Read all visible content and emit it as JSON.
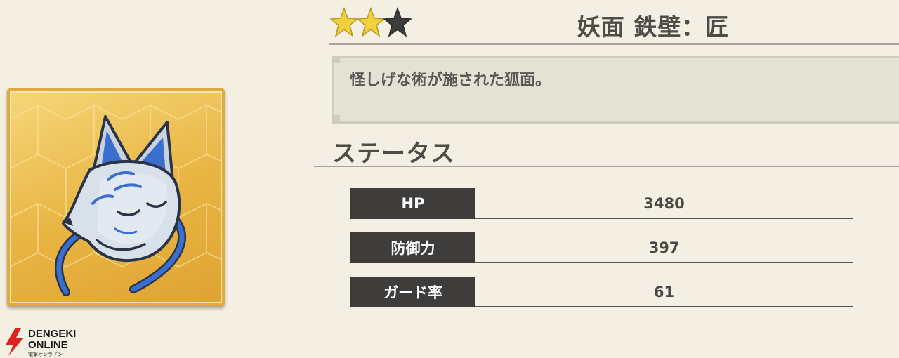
{
  "item": {
    "rarity": 2,
    "rarity_max": 3,
    "name": "妖面 鉄壁：匠",
    "description": "怪しげな術が施された狐面。",
    "icon": "fox-mask-icon"
  },
  "status": {
    "title": "ステータス",
    "rows": [
      {
        "label": "HP",
        "value": "3480"
      },
      {
        "label": "防御力",
        "value": "397"
      },
      {
        "label": "ガード率",
        "value": "61"
      }
    ]
  },
  "watermark": {
    "line1": "DENGEKI",
    "line2": "ONLINE",
    "line3": "電撃オンライン"
  },
  "colors": {
    "background": "#f3efe3",
    "star_filled": "#f2d23c",
    "star_empty": "#3e3d3d",
    "label_bg": "#3f3d3c",
    "card_gold": "#e8b442",
    "mask_blue": "#3a6fd0",
    "logo_red": "#e0201c"
  }
}
